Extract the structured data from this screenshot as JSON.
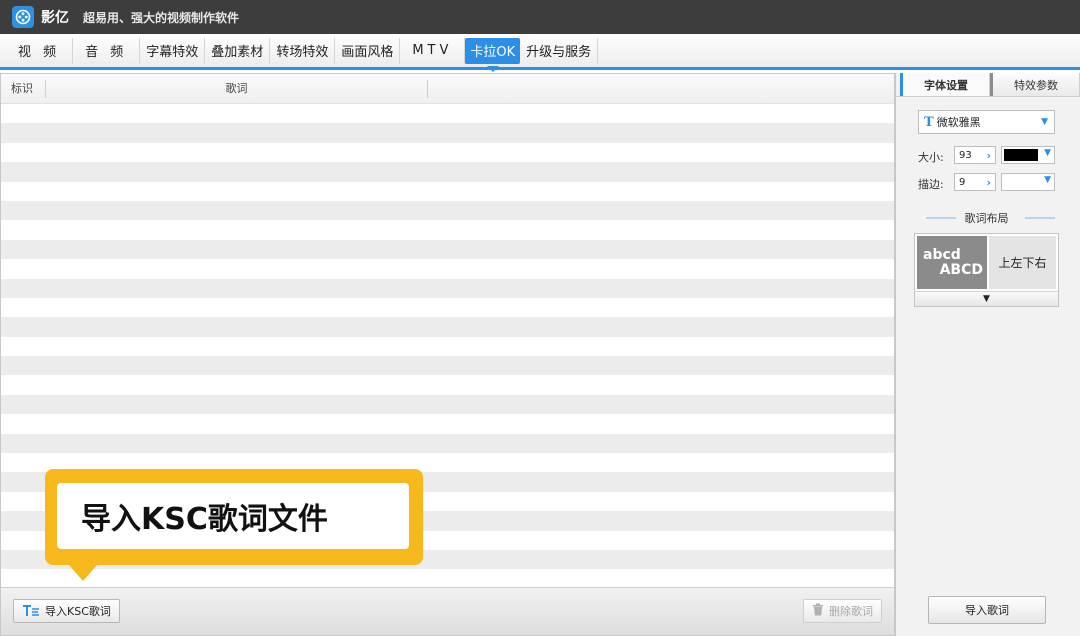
{
  "window": {
    "app_name": "影亿",
    "slogan": "超易用、强大的视频制作软件"
  },
  "tabs": [
    {
      "label": "视 频"
    },
    {
      "label": "音 频"
    },
    {
      "label": "字幕特效"
    },
    {
      "label": "叠加素材"
    },
    {
      "label": "转场特效"
    },
    {
      "label": "画面风格"
    },
    {
      "label": "MTV"
    },
    {
      "label": "卡拉OK",
      "active": true
    },
    {
      "label": "升级与服务"
    }
  ],
  "table": {
    "columns": [
      "标识",
      "歌词"
    ]
  },
  "bottom": {
    "import_label": "导入KSC歌词",
    "delete_label": "删除歌词"
  },
  "callout": {
    "text": "导入KSC歌词文件"
  },
  "side": {
    "tab_font": "字体设置",
    "tab_effect": "特效参数",
    "font_name": "微软雅黑",
    "size_label": "大小:",
    "size_value": "93",
    "stroke_label": "描边:",
    "stroke_value": "9",
    "font_color": "#000000",
    "section_title": "歌词布局",
    "layout_sample_line1": "abcd",
    "layout_sample_line2": "ABCD",
    "layout_name": "上左下右",
    "layout_more_icon": "▼",
    "bottom_button": "导入歌词"
  },
  "colors": {
    "accent": "#2d8ee8",
    "titlebar": "#3d3d3d",
    "callout": "#f7b81c"
  }
}
